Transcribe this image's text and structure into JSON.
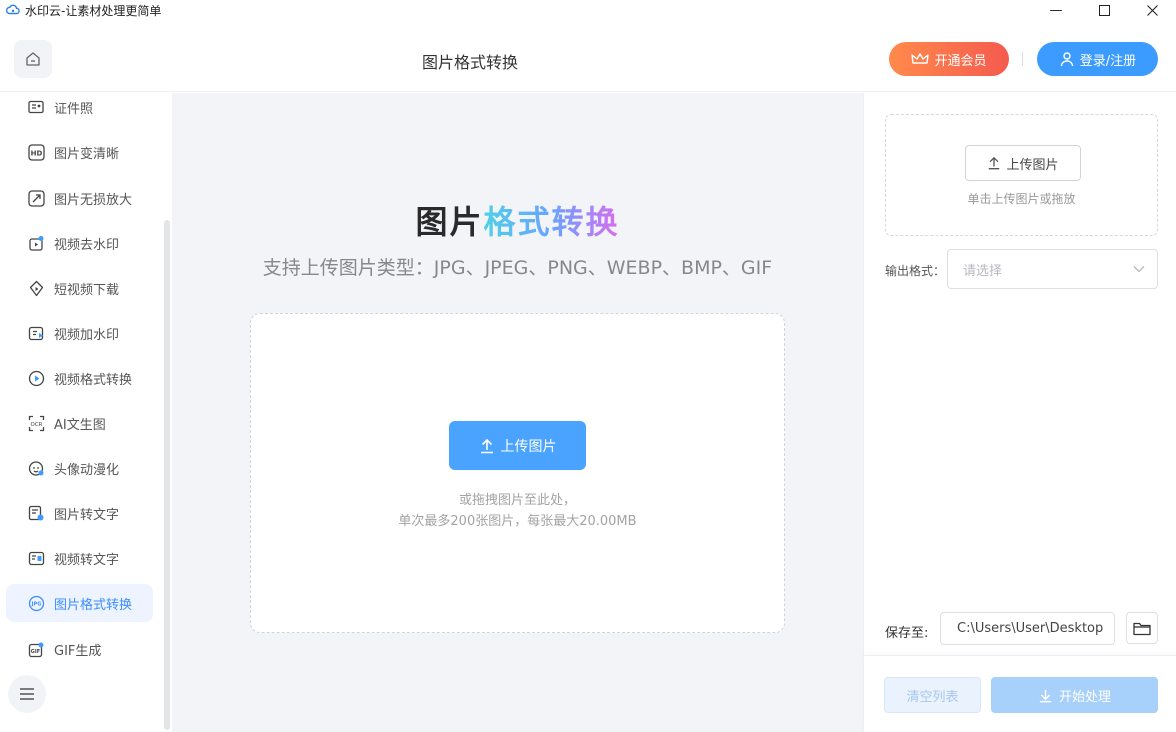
{
  "window": {
    "title": "水印云-让素材处理更简单",
    "minimize_glyph": "—",
    "maximize_glyph": "☐",
    "close_glyph": "✕"
  },
  "header": {
    "page_title": "图片格式转换",
    "vip_label": "开通会员",
    "login_label": "登录/注册"
  },
  "sidebar": {
    "items": [
      {
        "label": "证件照",
        "icon": "id-card-icon"
      },
      {
        "label": "图片变清晰",
        "icon": "hd-icon"
      },
      {
        "label": "图片无损放大",
        "icon": "enlarge-icon"
      },
      {
        "label": "视频去水印",
        "icon": "video-remove-watermark-icon"
      },
      {
        "label": "短视频下载",
        "icon": "short-video-download-icon"
      },
      {
        "label": "视频加水印",
        "icon": "video-add-watermark-icon"
      },
      {
        "label": "视频格式转换",
        "icon": "video-convert-icon"
      },
      {
        "label": "AI文生图",
        "icon": "ai-text-to-image-icon"
      },
      {
        "label": "头像动漫化",
        "icon": "avatar-anime-icon"
      },
      {
        "label": "图片转文字",
        "icon": "image-to-text-icon"
      },
      {
        "label": "视频转文字",
        "icon": "video-to-text-icon"
      },
      {
        "label": "图片格式转换",
        "icon": "jpg-icon",
        "active": true
      },
      {
        "label": "GIF生成",
        "icon": "gif-icon"
      }
    ]
  },
  "main": {
    "title_part1": "图片",
    "title_part2": "格式转换",
    "subtitle": "支持上传图片类型：JPG、JPEG、PNG、WEBP、BMP、GIF",
    "upload_label": "上传图片",
    "hint_line1": "或拖拽图片至此处，",
    "hint_line2": "单次最多200张图片，每张最大20.00MB"
  },
  "right_panel": {
    "upload_label": "上传图片",
    "upload_hint": "单击上传图片或拖放",
    "format_label": "输出格式：",
    "format_placeholder": "请选择",
    "save_label": "保存至:",
    "save_path": "C:\\Users\\User\\Desktop",
    "clear_label": "清空列表",
    "start_label": "开始处理"
  },
  "colors": {
    "accent": "#3c9bff",
    "vip_gradient_start": "#ff8a4c",
    "vip_gradient_end": "#f55a4e",
    "active_item_text": "#3c8cff"
  }
}
